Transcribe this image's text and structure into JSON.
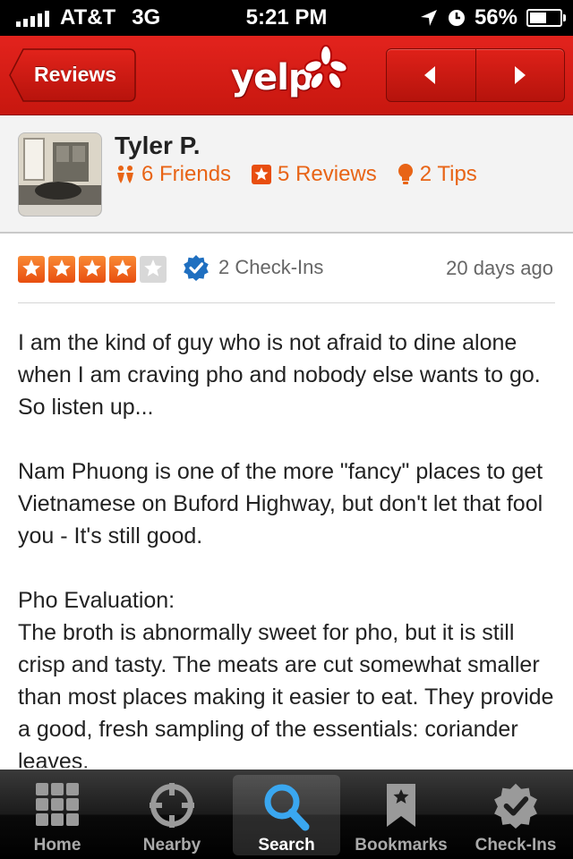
{
  "status_bar": {
    "carrier": "AT&T",
    "network": "3G",
    "time": "5:21 PM",
    "battery": "56%",
    "battery_level": 0.56,
    "signal_bars": 5
  },
  "nav": {
    "back_label": "Reviews",
    "logo": "yelp",
    "prev_icon": "left-arrow-icon",
    "next_icon": "right-arrow-icon"
  },
  "user": {
    "name": "Tyler P.",
    "friends": "6 Friends",
    "reviews": "5 Reviews",
    "tips": "2 Tips"
  },
  "review": {
    "rating": 4,
    "rating_max": 5,
    "checkins": "2 Check-Ins",
    "date": "20 days ago",
    "paragraphs": [
      "I am the kind of guy who is not afraid to dine alone when I am craving pho and nobody else wants to go. So listen up...",
      "Nam Phuong is one of the more \"fancy\" places to get Vietnamese on Buford Highway, but don't let that fool you - It's still good.",
      "Pho Evaluation:",
      "The broth is abnormally sweet for pho, but it is still crisp and tasty. The meats are cut somewhat smaller than most places making it easier to eat. They provide a good, fresh sampling of the essentials: coriander leaves,"
    ]
  },
  "tabs": [
    {
      "label": "Home",
      "icon": "grid-icon",
      "active": false
    },
    {
      "label": "Nearby",
      "icon": "crosshair-icon",
      "active": false
    },
    {
      "label": "Search",
      "icon": "magnifier-icon",
      "active": true
    },
    {
      "label": "Bookmarks",
      "icon": "bookmark-icon",
      "active": false
    },
    {
      "label": "Check-Ins",
      "icon": "checkin-badge-icon",
      "active": false
    }
  ],
  "colors": {
    "nav_red": "#d41c15",
    "accent_orange": "#e86416",
    "checkin_blue": "#1f6fc0"
  }
}
